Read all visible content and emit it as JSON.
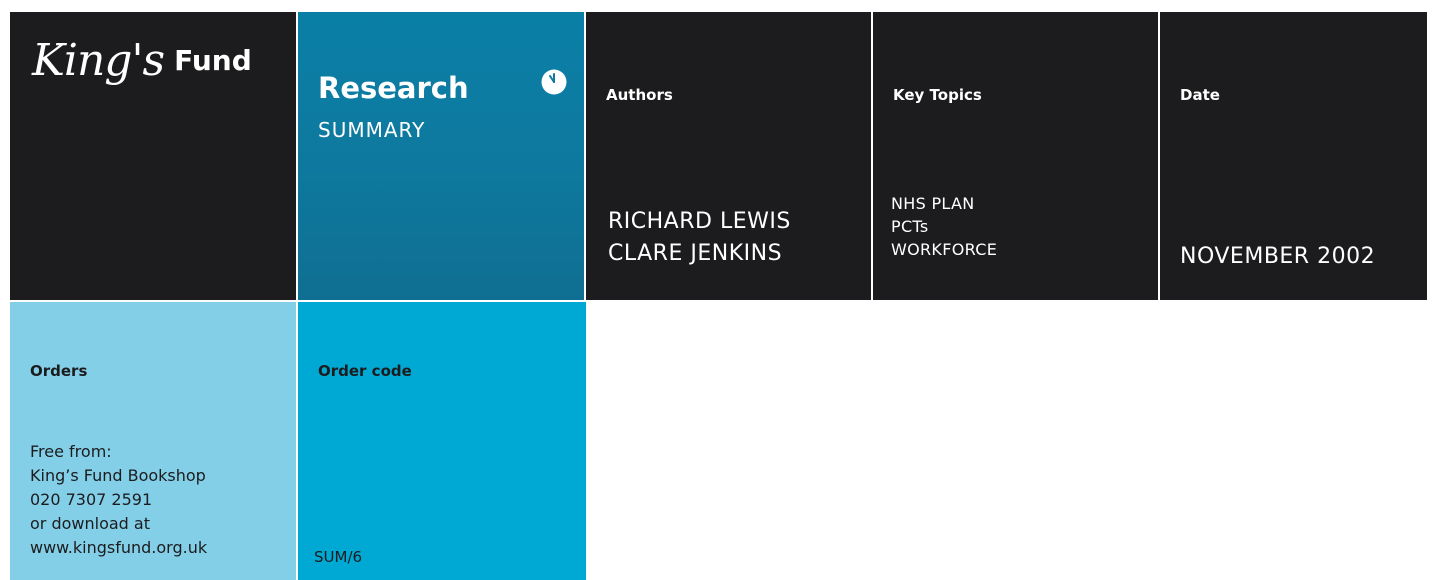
{
  "logo": {
    "script": "King's",
    "fund": "Fund"
  },
  "research": {
    "title": "Research",
    "subtitle": "SUMMARY",
    "icon": "clock-icon"
  },
  "authors": {
    "heading": "Authors",
    "names": [
      "RICHARD LEWIS",
      "CLARE JENKINS"
    ]
  },
  "topics": {
    "heading": "Key Topics",
    "items": [
      "NHS PLAN",
      "PCTs",
      "WORKFORCE"
    ]
  },
  "date": {
    "heading": "Date",
    "value": "NOVEMBER 2002"
  },
  "orders": {
    "heading": "Orders",
    "lines": [
      "Free from:",
      "King’s Fund Bookshop",
      "020 7307 2591",
      "or download at",
      "www.kingsfund.org.uk"
    ]
  },
  "order_code": {
    "heading": "Order code",
    "value": "SUM/6"
  },
  "colors": {
    "dark": "#1c1c1e",
    "teal": "#0e7aa0",
    "light_blue": "#83cfe8",
    "cyan": "#00a8d4"
  }
}
